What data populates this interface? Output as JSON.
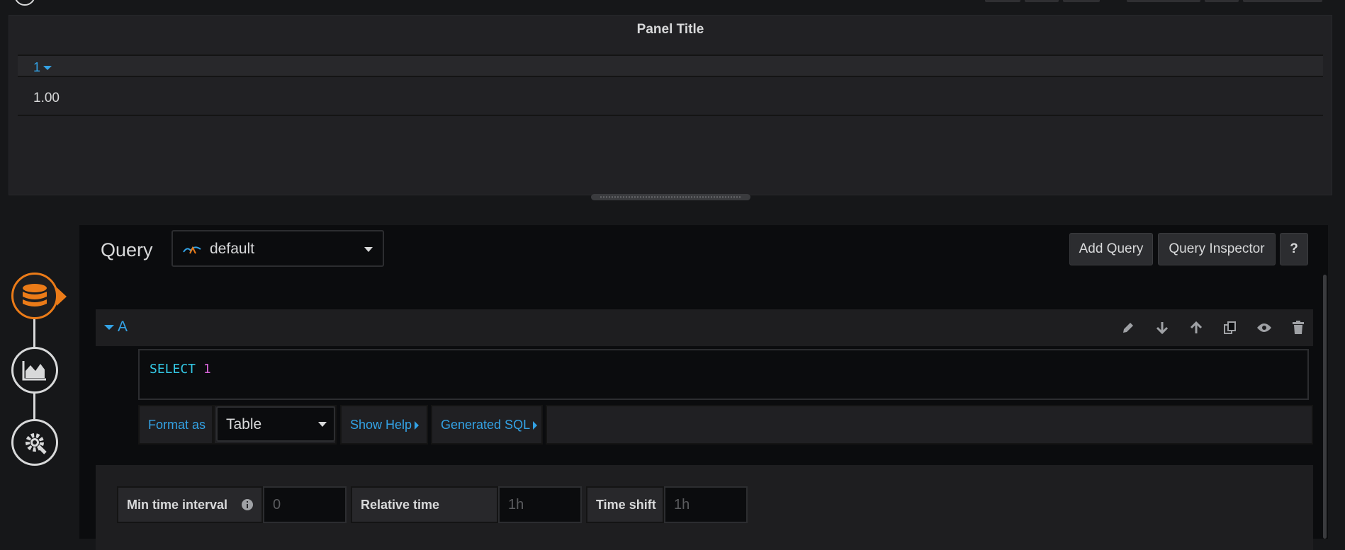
{
  "panel": {
    "title": "Panel Title",
    "table": {
      "column_header": "1",
      "rows": [
        "1.00"
      ]
    }
  },
  "query_editor": {
    "label": "Query",
    "datasource": "default",
    "buttons": {
      "add_query": "Add Query",
      "query_inspector": "Query Inspector",
      "help": "?"
    },
    "query_row": {
      "ref_id": "A",
      "sql_keyword": "SELECT",
      "sql_value": "1",
      "format_as_label": "Format as",
      "format_as_value": "Table",
      "show_help": "Show Help",
      "generated_sql": "Generated SQL"
    },
    "options": {
      "min_time_interval_label": "Min time interval",
      "min_time_interval_placeholder": "0",
      "relative_time_label": "Relative time",
      "relative_time_placeholder": "1h",
      "time_shift_label": "Time shift",
      "time_shift_placeholder": "1h"
    }
  },
  "colors": {
    "accent_blue": "#33a2e5",
    "accent_orange": "#eb7b18",
    "background": "#161719"
  },
  "icons": [
    "database-icon",
    "chart-icon",
    "settings-icon",
    "edit-icon",
    "move-down-icon",
    "move-up-icon",
    "duplicate-icon",
    "eye-icon",
    "trash-icon",
    "info-icon"
  ]
}
